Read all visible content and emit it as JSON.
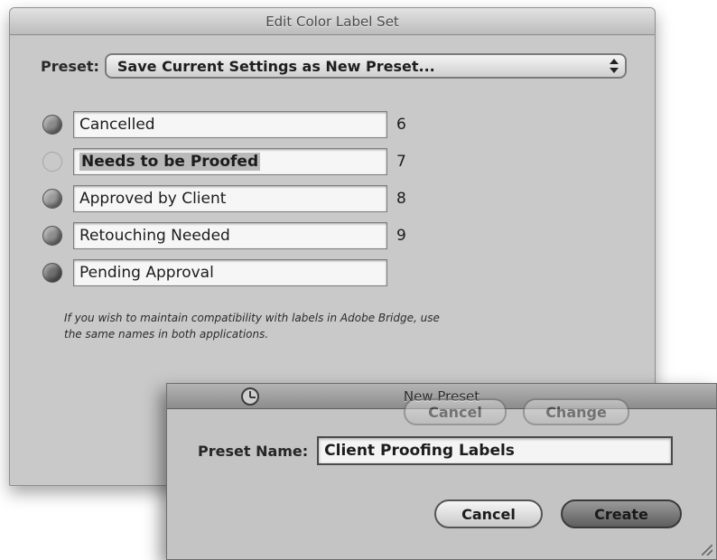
{
  "dialog": {
    "title": "Edit Color Label Set",
    "preset": {
      "label": "Preset:",
      "selected": "Save Current Settings as New Preset..."
    },
    "labels": [
      {
        "name": "Cancelled",
        "shortcut": "6",
        "color": "#8c8c8c",
        "faint": false,
        "selected": false
      },
      {
        "name": "Needs to be Proofed",
        "shortcut": "7",
        "color": "#c9c9c9",
        "faint": true,
        "selected": true
      },
      {
        "name": "Approved by Client",
        "shortcut": "8",
        "color": "#9a9a9a",
        "faint": false,
        "selected": false
      },
      {
        "name": "Retouching Needed",
        "shortcut": "9",
        "color": "#8f8f8f",
        "faint": false,
        "selected": false
      },
      {
        "name": "Pending Approval",
        "shortcut": "",
        "color": "#6f6f6f",
        "faint": false,
        "selected": false
      }
    ],
    "note": "If you wish to maintain compatibility with labels in Adobe Bridge, use the same names in both applications.",
    "underlying_buttons": {
      "cancel": "Cancel",
      "change": "Change"
    }
  },
  "sheet": {
    "title": "New Preset",
    "name_label": "Preset Name:",
    "name_value": "Client Proofing Labels",
    "cancel": "Cancel",
    "create": "Create"
  }
}
